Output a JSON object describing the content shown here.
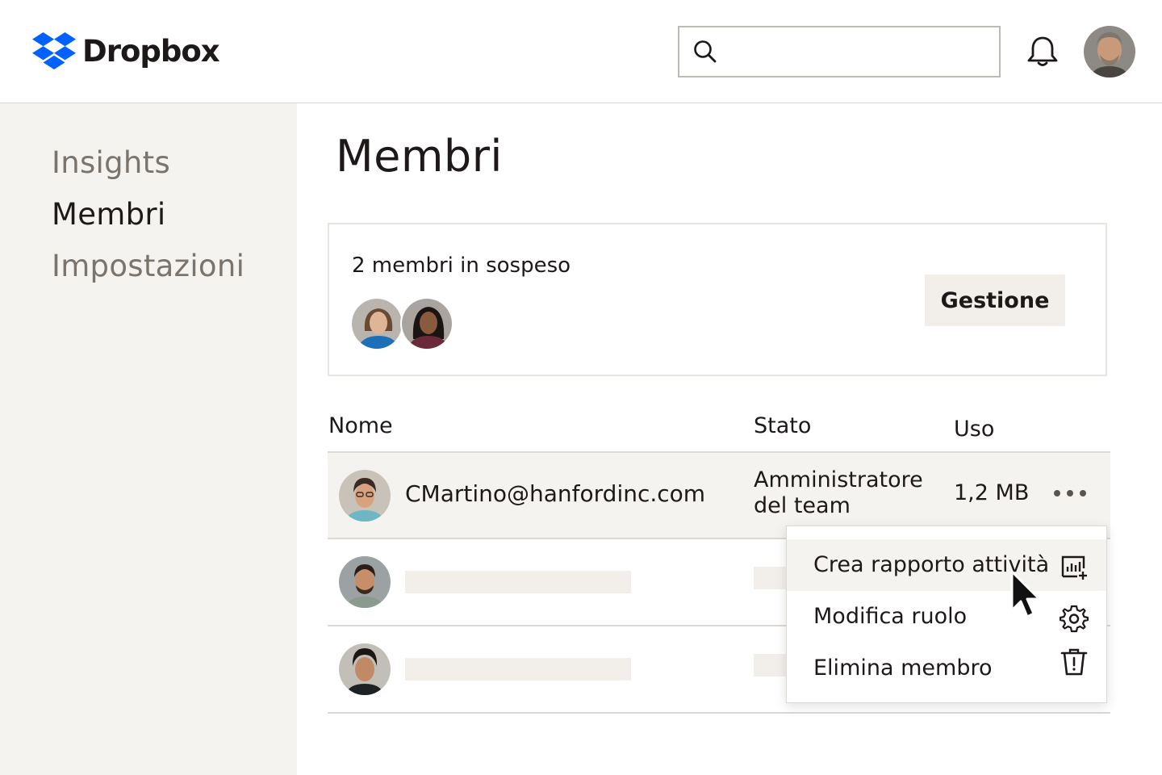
{
  "header": {
    "logo_text": "Dropbox",
    "search": {
      "placeholder": "",
      "value": ""
    }
  },
  "sidebar": {
    "items": [
      {
        "label": "Insights",
        "active": false
      },
      {
        "label": "Membri",
        "active": true
      },
      {
        "label": "Impostazioni",
        "active": false
      }
    ]
  },
  "main": {
    "title": "Membri",
    "pending": {
      "text": "2 membri in sospeso",
      "button_label": "Gestione"
    },
    "table": {
      "columns": [
        "Nome",
        "Stato",
        "Uso"
      ],
      "rows": [
        {
          "email": "CMartino@hanfordinc.com",
          "status": "Amministratore del team",
          "usage": "1,2 MB"
        }
      ]
    },
    "row_menu": {
      "items": [
        {
          "label": "Crea rapporto attività",
          "icon": "report-add-icon"
        },
        {
          "label": "Modifica ruolo",
          "icon": "gear-icon"
        },
        {
          "label": "Elimina membro",
          "icon": "trash-icon"
        }
      ]
    }
  },
  "colors": {
    "brand_blue": "#0061fe",
    "sidebar_bg": "#f5f3ef",
    "text": "#1e1919",
    "muted_text": "#7a746d"
  }
}
